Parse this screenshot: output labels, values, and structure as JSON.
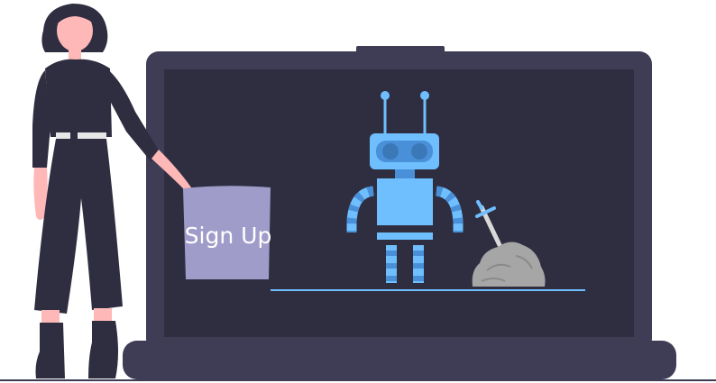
{
  "signup_card": {
    "label": "Sign Up"
  },
  "colors": {
    "laptop_body": "#3f3d56",
    "screen": "#2f2e41",
    "robot_blue": "#6fbfff",
    "robot_dark_blue": "#4a90d9",
    "floor_line": "#3f3d56",
    "ground_line": "#6fbfff",
    "card_fill": "#a09cc9",
    "skin": "#ffb8b8",
    "clothing": "#2f2e41",
    "rock": "#a6a6a6"
  },
  "icons": {
    "robot": "robot-icon",
    "sword_in_stone": "sword-in-stone-icon",
    "person": "person-illustration"
  }
}
